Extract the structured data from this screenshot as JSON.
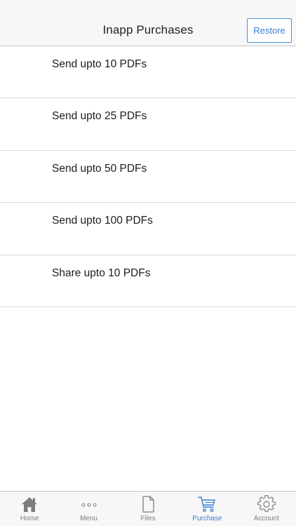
{
  "header": {
    "title": "Inapp Purchases",
    "restore_label": "Restore"
  },
  "purchases": [
    {
      "label": "Send upto 10 PDFs"
    },
    {
      "label": "Send upto 25 PDFs"
    },
    {
      "label": "Send upto 50 PDFs"
    },
    {
      "label": "Send upto 100 PDFs"
    },
    {
      "label": "Share upto 10 PDFs"
    }
  ],
  "tabbar": {
    "tabs": [
      {
        "label": "Home",
        "icon": "home-icon"
      },
      {
        "label": "Menu",
        "icon": "more-dots-icon"
      },
      {
        "label": "Files",
        "icon": "file-icon"
      },
      {
        "label": "Purchase",
        "icon": "cart-icon",
        "active": true
      },
      {
        "label": "Account",
        "icon": "gear-icon"
      }
    ]
  },
  "colors": {
    "accent": "#3b7fd0",
    "inactive": "#7d7d7d",
    "bar_background": "#f7f7f7",
    "separator": "#d9d9dc"
  }
}
